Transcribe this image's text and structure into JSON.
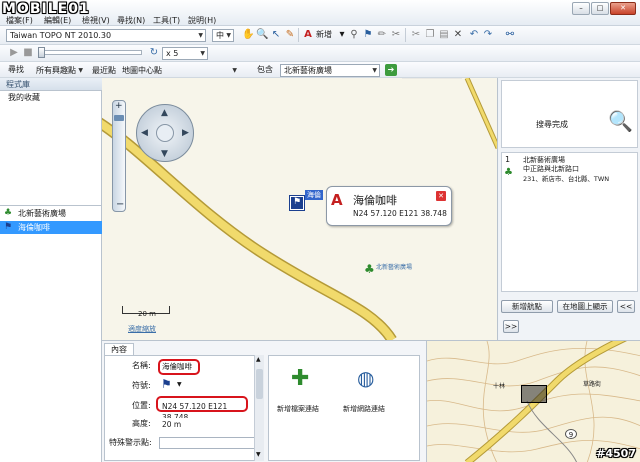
{
  "watermark_logo": "MOBILE01",
  "menu": {
    "file": "檔案(F)",
    "edit": "編輯(E)",
    "view": "檢視(V)",
    "find": "尋找(N)",
    "tools": "工具(T)",
    "help": "說明(H)"
  },
  "toolbar1": {
    "map_product": "Taiwan TOPO NT 2010.30",
    "detail": "中",
    "new_label": "新增"
  },
  "toolbar2": {
    "speed": "x 5"
  },
  "toolbar3": {
    "find": "尋找",
    "category": "所有興趣點",
    "near": "最近點",
    "map_center": "地圖中心點",
    "contains": "包含",
    "query": "北新藝術廣場"
  },
  "leftpanel": {
    "library_header": "程式庫",
    "favorites": "我的收藏",
    "items": [
      {
        "label": "北新藝術廣場"
      },
      {
        "label": "海倫咖啡"
      }
    ]
  },
  "map": {
    "popup_title": "海倫咖啡",
    "popup_coords": "N24 57.120 E121 38.748",
    "pin_label": "海倫",
    "poi_label": "北新藝術廣場",
    "scale_text": "20 m",
    "fit_label": "適度縮放"
  },
  "rightpanel": {
    "search_done": "搜尋完成",
    "result": {
      "index": "1",
      "name": "北新藝術廣場",
      "line2": "中正路與北新路口",
      "line3": "231、新店市、台北縣、TWN"
    },
    "new_waypoint": "新增航點",
    "show_on_map": "在地圖上顯示",
    "prev": "<<",
    "next": ">>"
  },
  "bottom": {
    "tab": "內容",
    "name_label": "名稱:",
    "name_value": "海倫咖啡",
    "symbol_label": "符號:",
    "position_label": "位置:",
    "position_value": "N24 57.120 E121 38.748",
    "height_label": "高度:",
    "height_value": "20 m",
    "proximity_label": "特殊警示點:",
    "add_file_link": "新增檔案連結",
    "add_web_link": "新增網路連結"
  },
  "minimap": {
    "label_a": "十林",
    "label_b": "草路街",
    "road_number": "9"
  },
  "footer": {
    "post_id": "#4507"
  },
  "colors": {
    "road": "#f1da6c",
    "road_border": "#b49a38",
    "selection": "#3399ff",
    "highlight": "#d8141c"
  }
}
